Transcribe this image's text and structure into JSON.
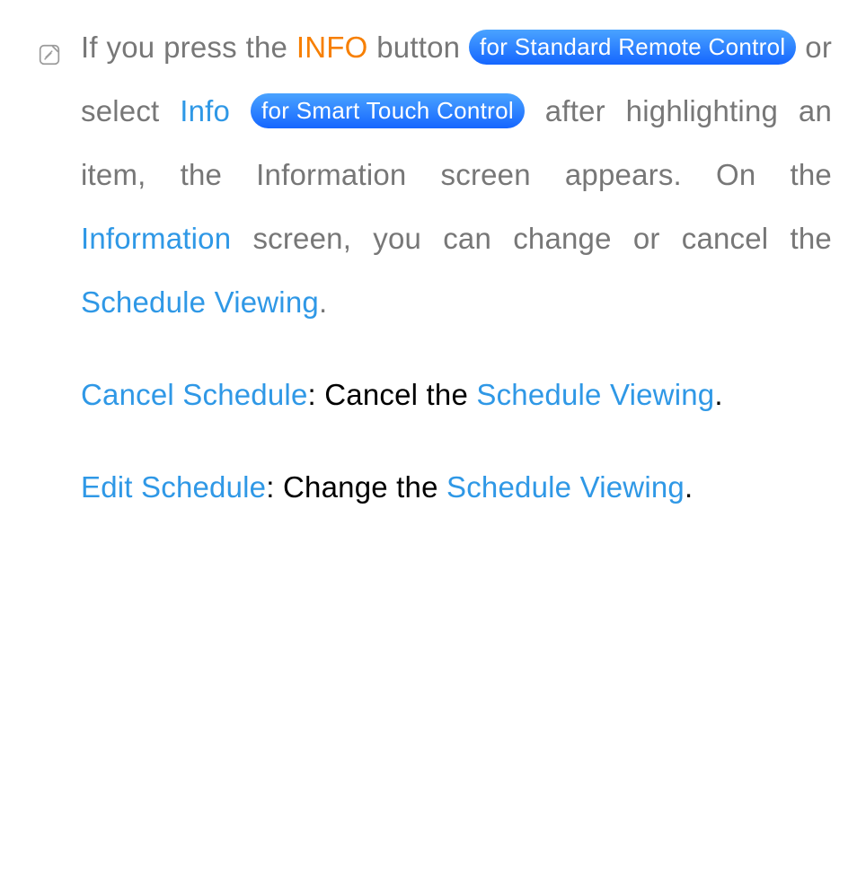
{
  "note": {
    "t1": "If you press the ",
    "info_btn": "INFO",
    "t2": " button ",
    "pill1": "for Standard Remote Control",
    "t3": " or select ",
    "info_link": "Info",
    "t4": " ",
    "pill2": "for Smart Touch Control",
    "t5": " after highlighting an item, the Information screen appears. On the ",
    "information_link": "Information",
    "t6": " screen, you can change or cancel the ",
    "schedule_viewing": "Schedule Viewing",
    "t7": "."
  },
  "cancel": {
    "label": "Cancel Schedule",
    "colon": ": ",
    "desc1": "Cancel the ",
    "sv": "Schedule Viewing",
    "dot": "."
  },
  "edit": {
    "label": "Edit Schedule",
    "colon": ": ",
    "desc1": "Change the ",
    "sv": "Schedule Viewing",
    "dot": "."
  }
}
